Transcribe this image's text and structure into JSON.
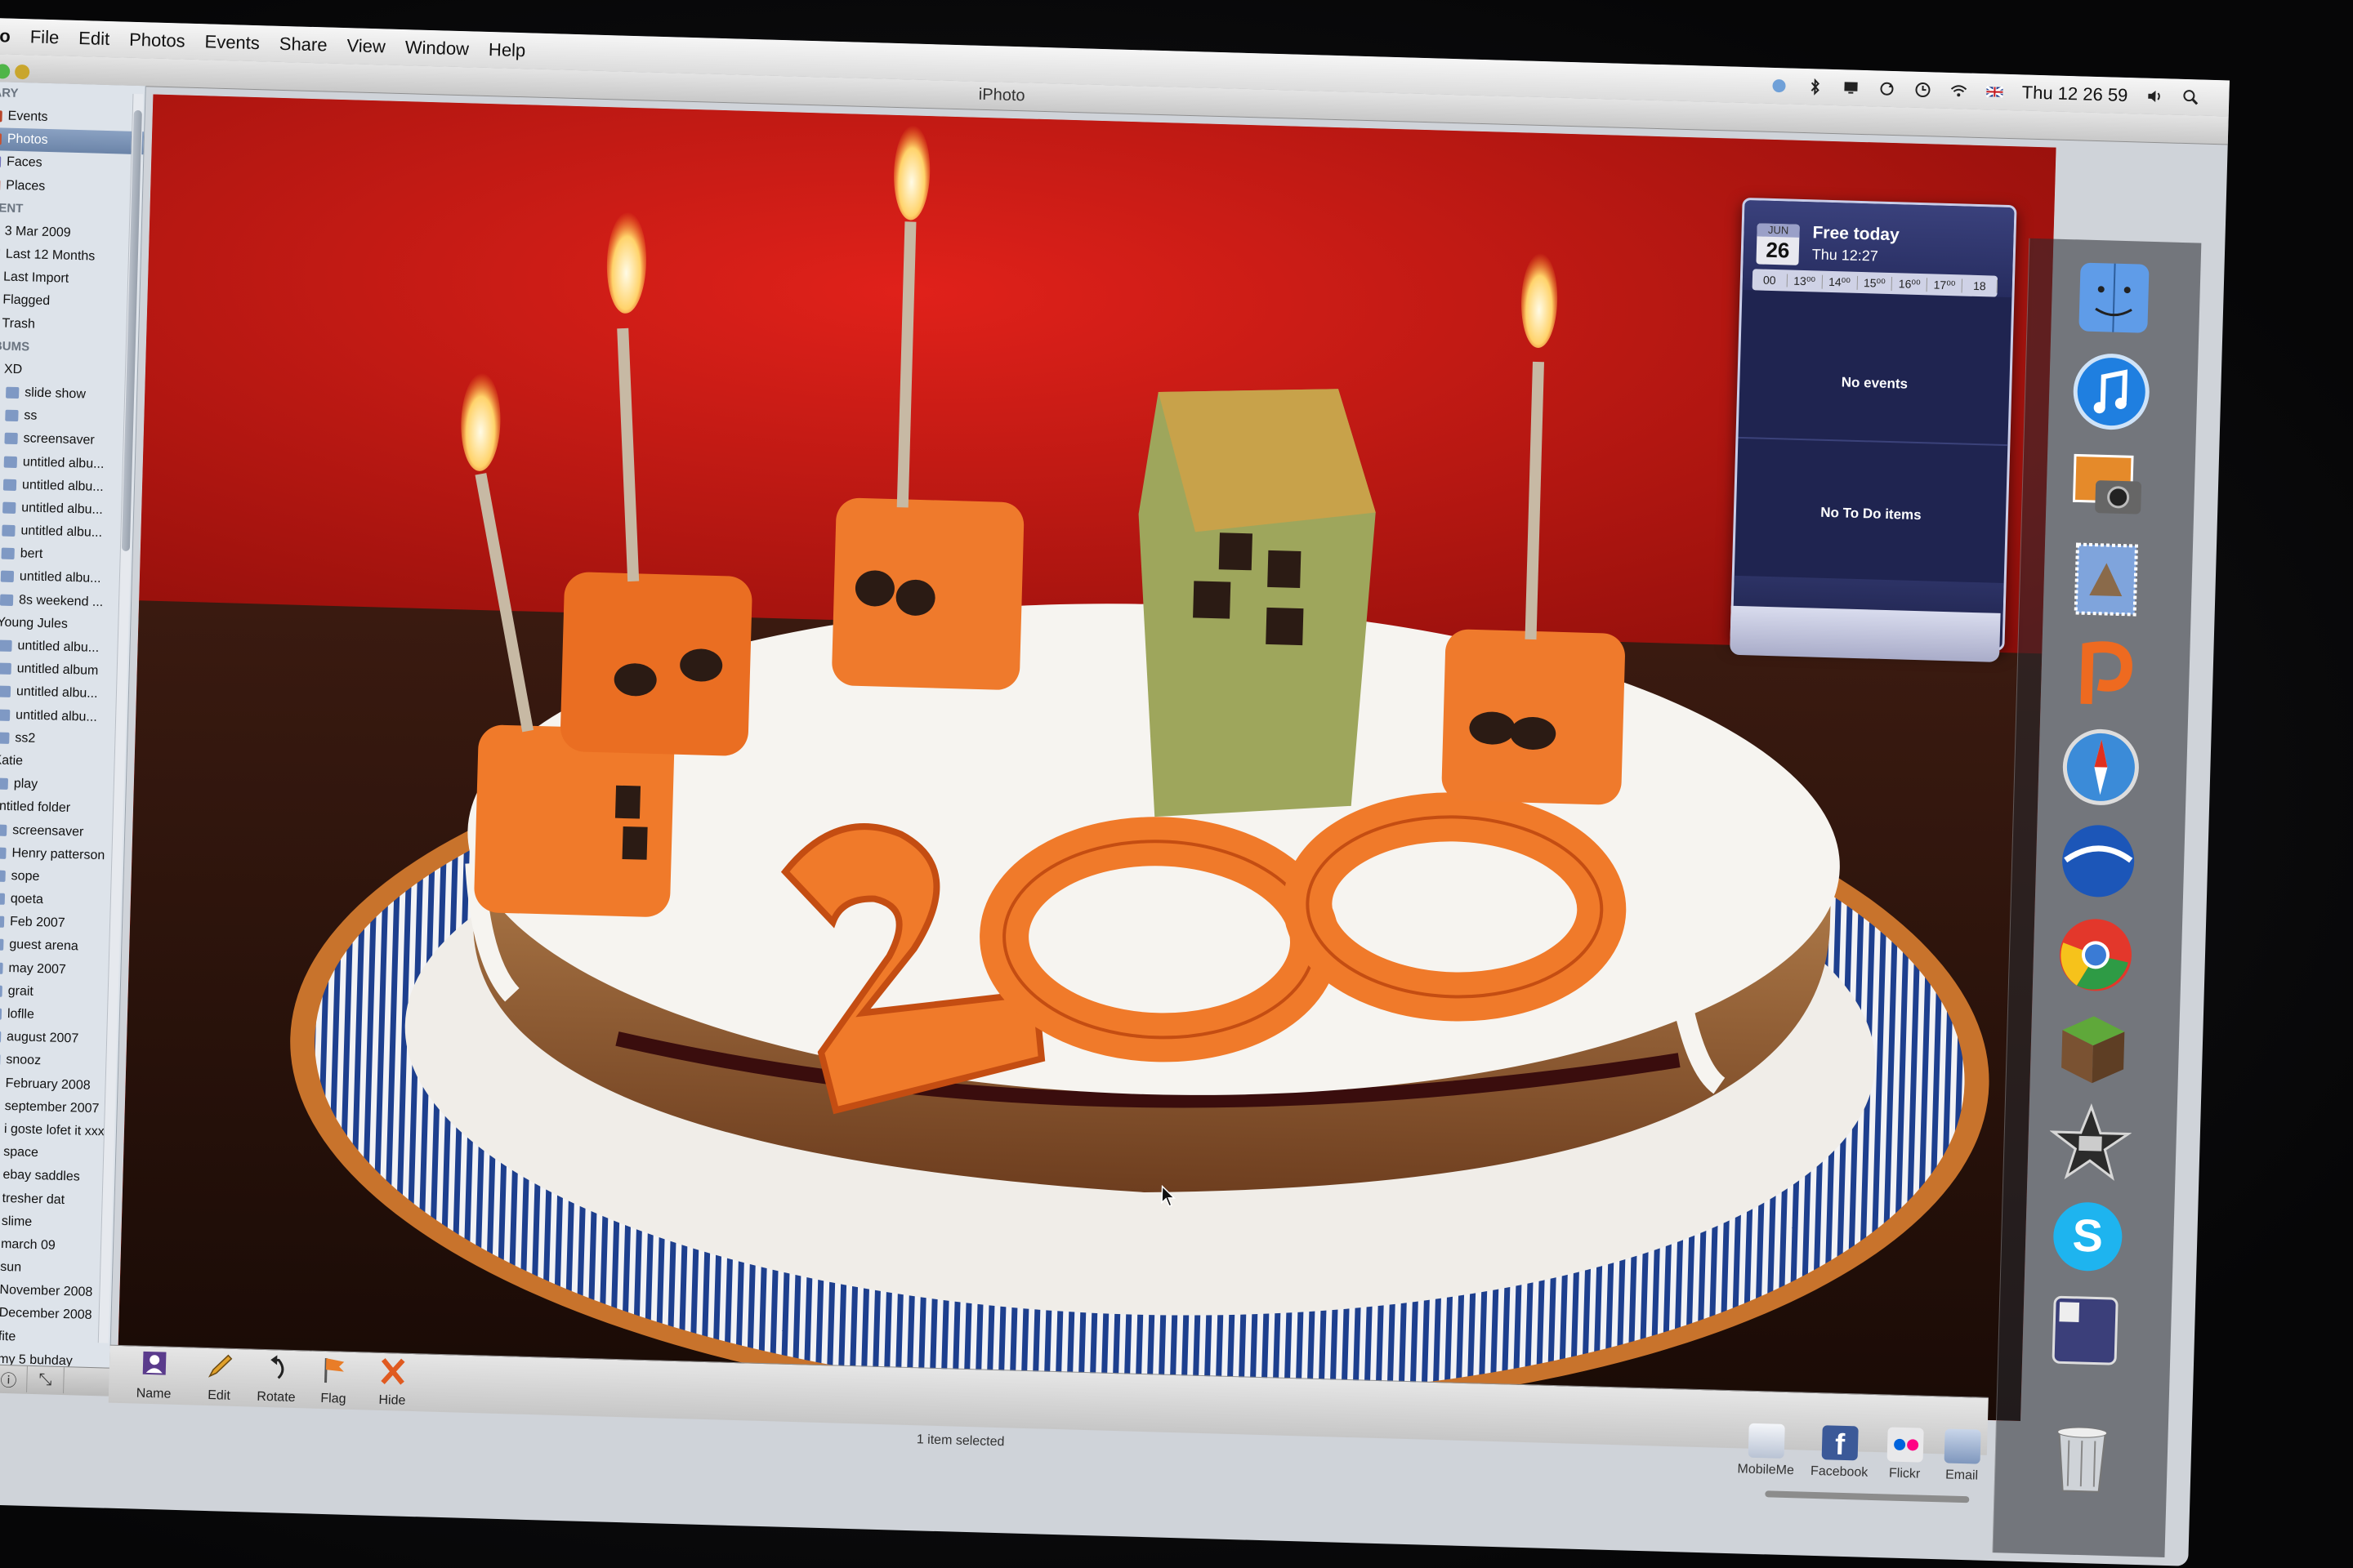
{
  "menubar": {
    "app_menu": "o",
    "menus": [
      "File",
      "Edit",
      "Photos",
      "Events",
      "Share",
      "View",
      "Window",
      "Help"
    ],
    "clock": "Thu 12 26 59"
  },
  "window": {
    "title": "iPhoto"
  },
  "sidebar": {
    "sections": {
      "library": "ARY",
      "recent": "CENT",
      "albums": "LBUMS"
    },
    "library_items": [
      {
        "label": "Events",
        "icon": "events-icon"
      },
      {
        "label": "Photos",
        "icon": "photos-icon",
        "selected": true
      },
      {
        "label": "Faces",
        "icon": "faces-icon"
      },
      {
        "label": "Places",
        "icon": "places-icon"
      }
    ],
    "recent_items": [
      {
        "label": "3 Mar 2009"
      },
      {
        "label": "Last 12 Months"
      },
      {
        "label": "Last Import"
      },
      {
        "label": "Flagged"
      },
      {
        "label": "Trash"
      }
    ],
    "album_items": [
      "XD",
      "slide show",
      "ss",
      "screensaver",
      "untitled albu...",
      "untitled albu...",
      "untitled albu...",
      "untitled albu...",
      "bert",
      "untitled albu...",
      "8s weekend ...",
      "Young Jules",
      "untitled albu...",
      "untitled album",
      "untitled albu...",
      "untitled albu...",
      "ss2",
      "Katie",
      "play",
      "untitled folder",
      "screensaver",
      "Henry patterson",
      "sope",
      "qoeta",
      "Feb 2007",
      "guest arena",
      "may 2007",
      "grait",
      "loflle",
      "august 2007",
      "snooz",
      "February 2008",
      "september 2007",
      "i goste lofet it xxx",
      "space",
      "ebay saddles",
      "tresher dat",
      "slime",
      "march 09",
      "sun",
      "November 2008",
      "December 2008",
      "fite",
      "my 5 buhday"
    ]
  },
  "photo": {
    "cake_text": "200"
  },
  "toolbar": {
    "name_label": "Name",
    "edit_label": "Edit",
    "rotate_label": "Rotate",
    "flag_label": "Flag",
    "hide_label": "Hide"
  },
  "status": {
    "text": "1 item selected"
  },
  "share": {
    "mobileme_label": "MobileMe",
    "facebook_label": "Facebook",
    "flickr_label": "Flickr",
    "email_label": "Email"
  },
  "widget": {
    "month": "JUN",
    "day": "26",
    "free_label": "Free today",
    "time_label": "Thu 12:27",
    "hours": [
      "00",
      "13⁰⁰",
      "14⁰⁰",
      "15⁰⁰",
      "16⁰⁰",
      "17⁰⁰",
      "18"
    ],
    "no_events": "No events",
    "no_todo": "No To Do items"
  },
  "colors": {
    "wall_red": "#c81710",
    "plate_blue": "#1d3f8e",
    "icing_white": "#f4f2ee",
    "marzipan_orange": "#f07a2a",
    "widget_navy": "#1f2450"
  }
}
